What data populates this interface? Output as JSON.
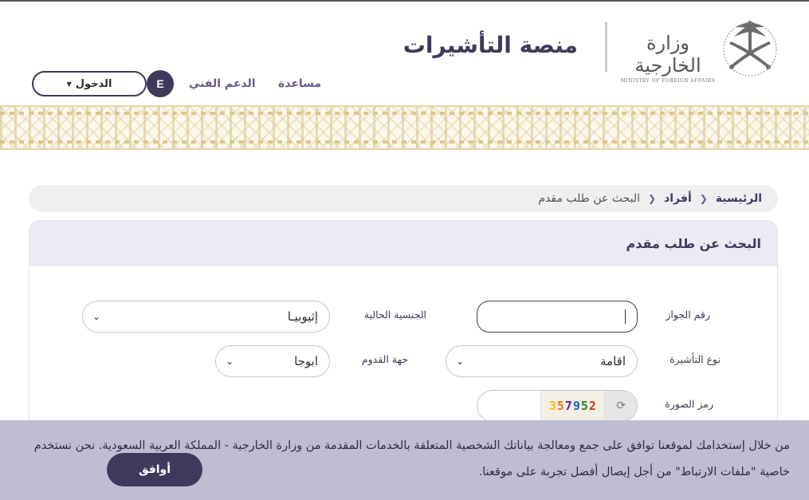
{
  "header": {
    "platform_title": "منصة التأشيرات",
    "ministry_name_ar": "وزارة الخارجية",
    "ministry_name_en": "MINISTRY OF FOREIGN AFFAIRS"
  },
  "nav": {
    "help": "مساعدة",
    "support": "الدعم الفني",
    "login": "الدخول",
    "language": "E"
  },
  "breadcrumb": {
    "home": "الرئيسية",
    "individuals": "أفراد",
    "current": "البحث عن طلب مقدم"
  },
  "card": {
    "title": "البحث عن طلب مقدم"
  },
  "form": {
    "passport_label": "رقم الجواز",
    "passport_value": "",
    "nationality_label": "الجنسية الحالية",
    "nationality_value": "إثيوبيـا",
    "visa_type_label": "نوع التأشيرة",
    "visa_type_value": "اقامة",
    "arrival_label": "جهة القدوم",
    "arrival_value": "ابوجا",
    "captcha_label": "رمز الصورة",
    "captcha_code": "25975 3"
  },
  "cookie": {
    "text": "من خلال إستخدامك لموقعنا توافق على جمع ومعالجة بياناتك الشخصية المتعلقة بالخدمات المقدمة من وزارة الخارجية - المملكة العربية السعودية. نحن نستخدم خاصية \"ملفات الارتباط\" من أجل إيصال أفضل تجربة على موقعنا.",
    "agree": "أوافق"
  }
}
